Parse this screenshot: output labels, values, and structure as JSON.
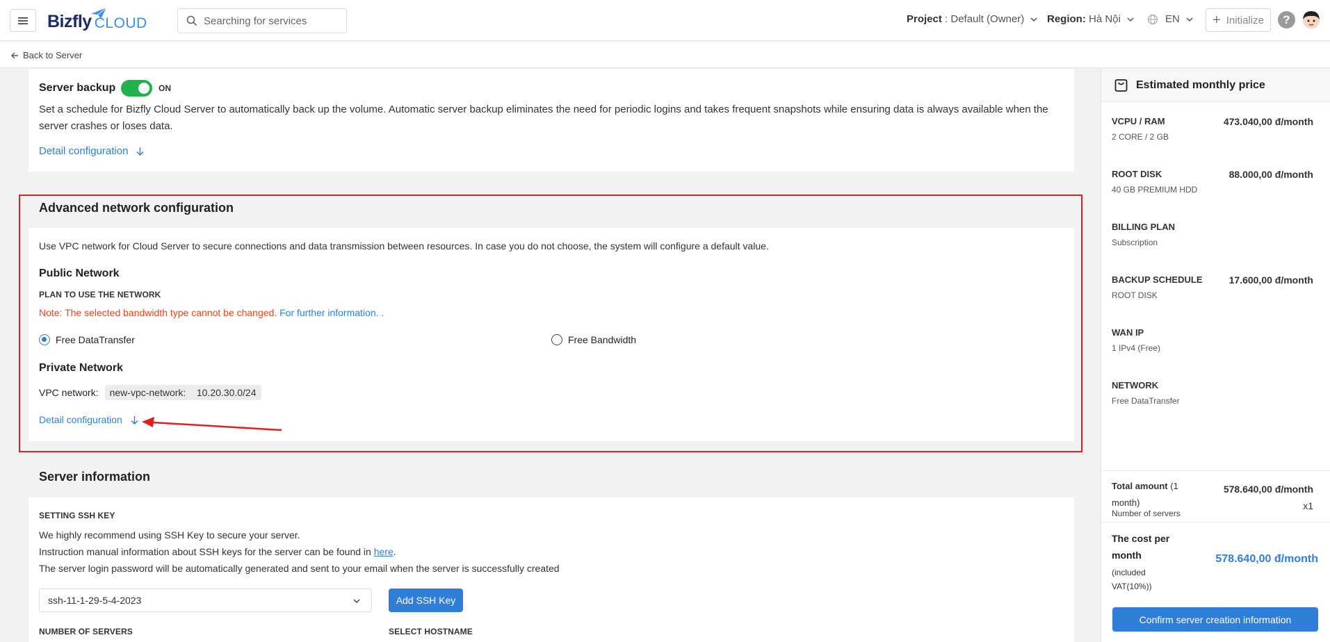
{
  "header": {
    "logo_main": "Bizfly",
    "logo_sub": "CLOUD",
    "search_placeholder": "Searching for services",
    "project_label": "Project",
    "project_value": ": Default (Owner)",
    "region_label": "Region:",
    "region_value": "Hà Nội",
    "language": "EN",
    "initialize_label": "Initialize",
    "help_label": "?"
  },
  "subheader": {
    "back_label": "Back to Server"
  },
  "backup": {
    "title": "Server backup",
    "toggle_state": "ON",
    "description": "Set a schedule for Bizfly Cloud Server to automatically back up the volume. Automatic server backup eliminates the need for periodic logins and takes frequent snapshots while ensuring data is always available when the server crashes or loses data.",
    "detail_link": "Detail configuration"
  },
  "network": {
    "title": "Advanced network configuration",
    "description": "Use VPC network for Cloud Server to secure connections and data transmission between resources. In case you do not choose, the system will configure a default value.",
    "public_title": "Public Network",
    "plan_label": "PLAN TO USE THE NETWORK",
    "note": "Note: The selected bandwidth type cannot be changed.",
    "note_link": "For further information.",
    "note_tail": ".",
    "options": [
      "Free DataTransfer",
      "Free Bandwidth"
    ],
    "selected_option": "Free DataTransfer",
    "private_title": "Private Network",
    "vpc_label": "VPC network:",
    "vpc_name": "new-vpc-network:",
    "vpc_cidr": "10.20.30.0/24",
    "detail_link": "Detail configuration"
  },
  "server_info": {
    "title": "Server information",
    "ssh_label": "SETTING SSH KEY",
    "line1": "We highly recommend using SSH Key to secure your server.",
    "line2_prefix": "Instruction manual information about SSH keys for the server can be found in",
    "line2_link": "here",
    "line2_suffix": ".",
    "line3": "The server login password will be automatically generated and sent to your email when the server is successfully created",
    "ssh_selected": "ssh-11-1-29-5-4-2023",
    "add_ssh_label": "Add SSH Key",
    "num_servers_label": "NUMBER OF SERVERS",
    "hostname_label": "SELECT HOSTNAME"
  },
  "price": {
    "title": "Estimated monthly price",
    "rows": [
      {
        "label": "VCPU / RAM",
        "sub": "2 CORE / 2 GB",
        "value": "473.040,00 đ/month"
      },
      {
        "label": "ROOT DISK",
        "sub": "40 GB PREMIUM HDD",
        "value": "88.000,00 đ/month"
      },
      {
        "label": "BILLING PLAN",
        "sub": "Subscription",
        "value": ""
      },
      {
        "label": "BACKUP SCHEDULE",
        "sub": "ROOT DISK",
        "value": "17.600,00 đ/month"
      },
      {
        "label": "WAN IP",
        "sub": "1 IPv4 (Free)",
        "value": ""
      },
      {
        "label": "NETWORK",
        "sub": "Free DataTransfer",
        "value": ""
      }
    ],
    "total_label": "Total amount",
    "total_paren_open": "(1",
    "total_paren_close": "month)",
    "total_value": "578.640,00 đ/month",
    "servers_label": "Number of servers",
    "servers_value": "x1",
    "cost_label_1": "The cost per",
    "cost_label_2": "month",
    "cost_sub_1": "(included",
    "cost_sub_2": "VAT(10%))",
    "cost_value": "578.640,00 đ/month",
    "confirm_label": "Confirm server creation information"
  },
  "colors": {
    "primary": "#2f7ed8",
    "toggle_on": "#21b24b",
    "warning": "#e8461d",
    "highlight": "#e02020"
  }
}
